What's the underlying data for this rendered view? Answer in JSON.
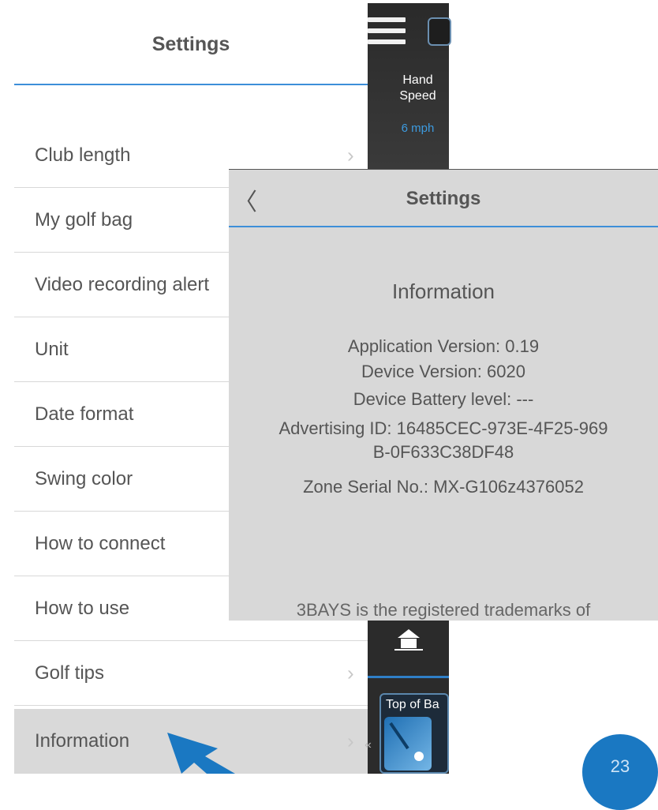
{
  "left_panel": {
    "title": "Settings",
    "items": [
      {
        "label": "Club length",
        "chevron": "›"
      },
      {
        "label": "My golf bag",
        "chevron": "›"
      },
      {
        "label": "Video recording alert",
        "chevron": "›"
      },
      {
        "label": "Unit",
        "chevron": "›"
      },
      {
        "label": "Date format",
        "chevron": "›"
      },
      {
        "label": "Swing color",
        "chevron": "›"
      },
      {
        "label": "How to connect",
        "chevron": "›"
      },
      {
        "label": "How to use",
        "chevron": "›"
      },
      {
        "label": "Golf tips",
        "chevron": "›"
      },
      {
        "label": "Information",
        "chevron": "›"
      }
    ]
  },
  "background_app": {
    "hand_speed_label": "Hand Speed",
    "hand_speed_value": "6 mph",
    "thumbnail_label": "Top of Ba",
    "thumbnail_chevron": "«"
  },
  "info_panel": {
    "back_glyph": "〈",
    "title": "Settings",
    "heading": "Information",
    "lines": [
      "Application Version: 0.19",
      "Device Version: 6020",
      "Device Battery level: ---",
      "Advertising ID: 16485CEC-973E-4F25-969",
      "B-0F633C38DF48",
      "Zone Serial No.: MX-G106z4376052"
    ],
    "trademark": "3BAYS is the registered trademarks of"
  },
  "page_badge": {
    "number": "23"
  },
  "colors": {
    "accent": "#3d8fd9",
    "highlight_row": "#d9d9d9",
    "badge": "#1a78c2"
  }
}
